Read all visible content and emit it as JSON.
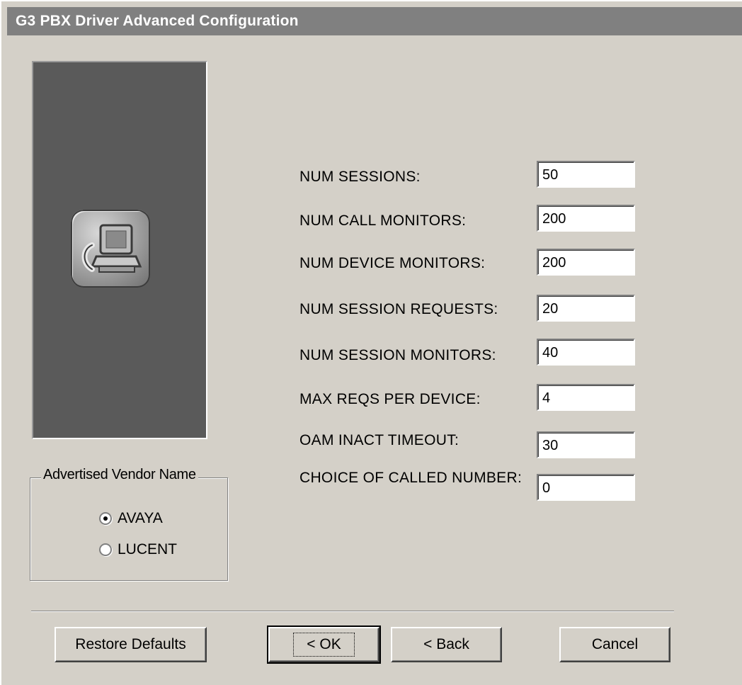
{
  "window": {
    "title": "G3 PBX Driver Advanced Configuration"
  },
  "vendor_group": {
    "label": "Advertised Vendor Name",
    "options": [
      {
        "label": "AVAYA",
        "checked": true
      },
      {
        "label": "LUCENT",
        "checked": false
      }
    ]
  },
  "fields": [
    {
      "label": "NUM SESSIONS:",
      "value": "50"
    },
    {
      "label": "NUM CALL MONITORS:",
      "value": "200"
    },
    {
      "label": "NUM DEVICE MONITORS:",
      "value": "200"
    },
    {
      "label": "NUM SESSION REQUESTS:",
      "value": "20"
    },
    {
      "label": "NUM SESSION MONITORS:",
      "value": "40"
    },
    {
      "label": "MAX REQS PER DEVICE:",
      "value": "4"
    },
    {
      "label": "OAM INACT TIMEOUT:",
      "value": "30"
    },
    {
      "label": "CHOICE OF CALLED NUMBER:",
      "value": "0"
    }
  ],
  "buttons": {
    "restore_defaults": "Restore Defaults",
    "ok": "< OK",
    "back": "< Back",
    "cancel": "Cancel"
  },
  "icons": {
    "app_icon": "telephone-computer-icon"
  }
}
